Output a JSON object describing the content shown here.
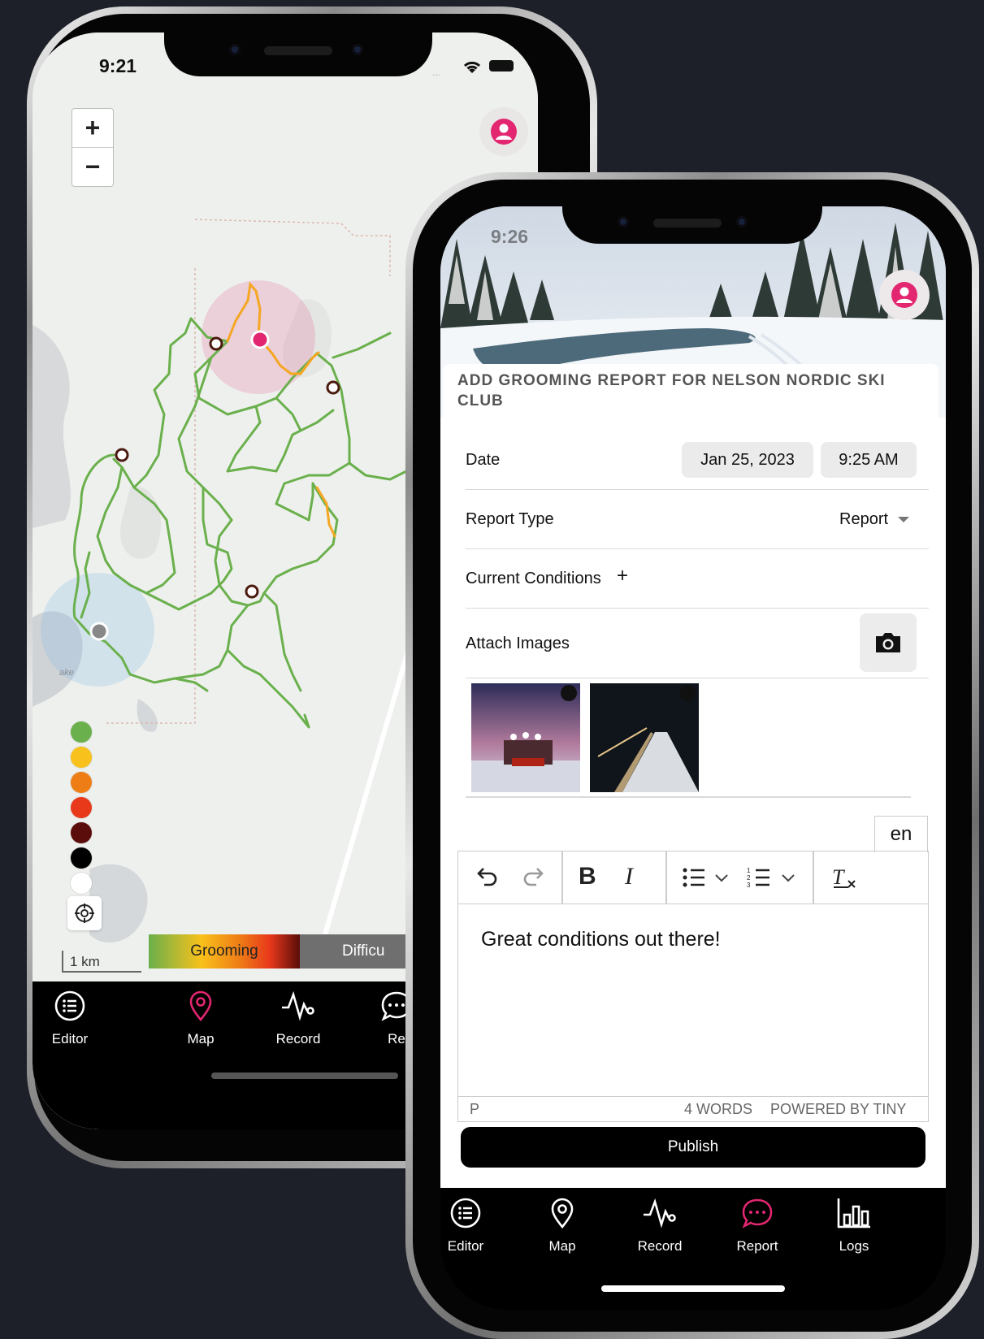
{
  "phone_map": {
    "status_time": "9:21",
    "zoom_in_label": "+",
    "zoom_out_label": "−",
    "scale_label": "1 km",
    "map_label_lake": "ake",
    "legend_colors": [
      "#6ab04c",
      "#f9c11b",
      "#ee7d16",
      "#e8391b",
      "#5a0d0a",
      "#000000",
      "#ffffff"
    ],
    "layer_tabs": {
      "grooming": "Grooming",
      "difficulty": "Difficu"
    },
    "tabs": [
      {
        "label": "Editor",
        "icon": "list-icon"
      },
      {
        "label": "Map",
        "icon": "map-pin-icon",
        "active": true
      },
      {
        "label": "Record",
        "icon": "pulse-icon"
      },
      {
        "label": "Re",
        "icon": "chat-icon"
      }
    ],
    "accent_color": "#e2266f"
  },
  "phone_report": {
    "status_time": "9:26",
    "header_title": "ADD GROOMING REPORT FOR NELSON NORDIC SKI CLUB",
    "date_label": "Date",
    "date_value": "Jan 25, 2023",
    "time_value": "9:25 AM",
    "report_type_label": "Report Type",
    "report_type_value": "Report",
    "conditions_label": "Current Conditions",
    "conditions_add": "+",
    "attach_label": "Attach Images",
    "lang_tab": "en",
    "editor_text": "Great conditions out there!",
    "editor_footer_path": "P",
    "editor_word_count": "4 WORDS",
    "editor_powered": "POWERED BY TINY",
    "toolbar": {
      "bold": "B",
      "italic": "I"
    },
    "publish_label": "Publish",
    "tabs": [
      {
        "label": "Editor",
        "icon": "list-icon"
      },
      {
        "label": "Map",
        "icon": "map-pin-icon"
      },
      {
        "label": "Record",
        "icon": "pulse-icon"
      },
      {
        "label": "Report",
        "icon": "chat-icon",
        "active": true
      },
      {
        "label": "Logs",
        "icon": "bar-chart-icon"
      }
    ],
    "accent_color": "#e2266f"
  }
}
